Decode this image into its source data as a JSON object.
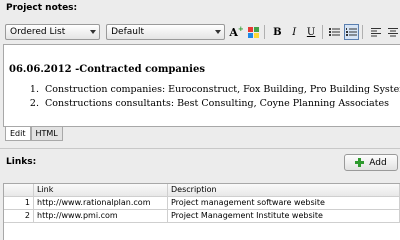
{
  "notes": {
    "label": "Project notes:",
    "toolbar": {
      "style_value": "Ordered List",
      "font_value": "Default",
      "font_size_label": "A",
      "bold_label": "B",
      "italic_label": "I",
      "underline_label": "U"
    },
    "editor": {
      "heading": "06.06.2012 -Contracted companies",
      "items": [
        {
          "num": "1.",
          "text": "Construction companies: Euroconstruct, Fox Building, Pro Building Systems,"
        },
        {
          "num": "2.",
          "text": "Constructions consultants: Best Consulting, Coyne Planning Associates"
        }
      ]
    },
    "tabs": [
      "Edit",
      "HTML"
    ]
  },
  "links": {
    "label": "Links:",
    "add_label": "Add",
    "columns": [
      "",
      "Link",
      "Description"
    ],
    "rows": [
      {
        "num": "1",
        "link": "http://www.rationalplan.com",
        "description": "Project management software website"
      },
      {
        "num": "2",
        "link": "http://www.pmi.com",
        "description": "Project Management Institute website"
      }
    ]
  }
}
